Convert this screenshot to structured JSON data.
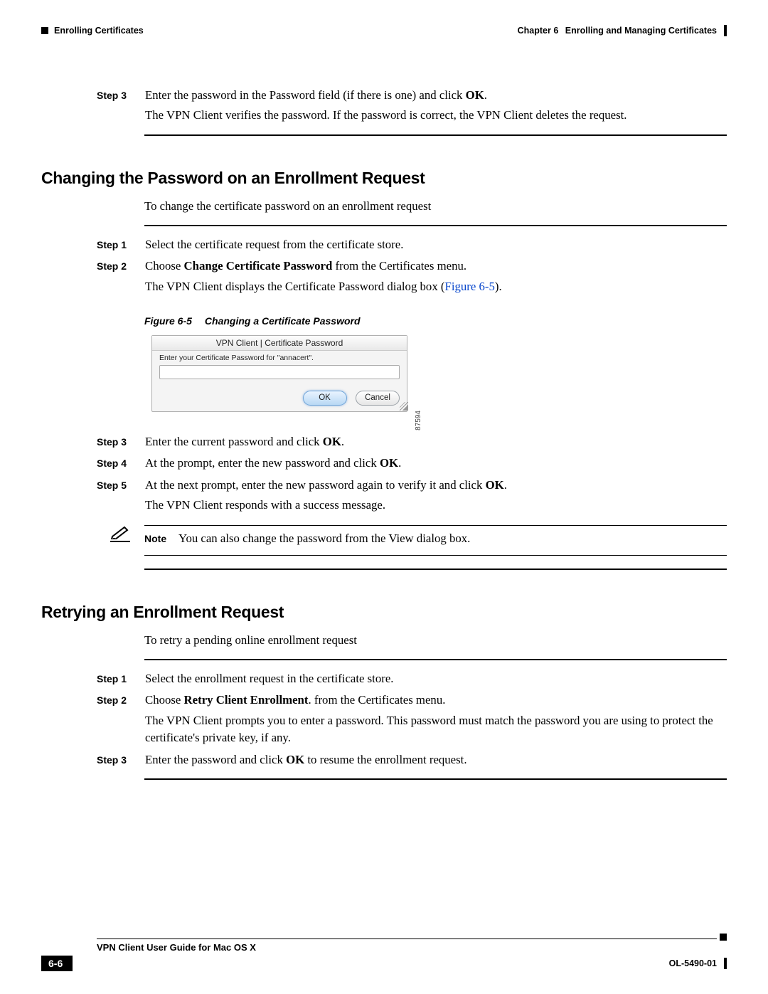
{
  "header": {
    "left_section": "Enrolling Certificates",
    "right_chapter_label": "Chapter 6",
    "right_chapter_title": "Enrolling and Managing Certificates"
  },
  "intro_step": {
    "label": "Step 3",
    "line1a": "Enter the password in the Password field (if there is one) and click ",
    "line1b": "OK",
    "line1c": ".",
    "line2": "The VPN Client verifies the password. If the password is correct, the VPN Client deletes the request."
  },
  "section1": {
    "heading": "Changing the Password on an Enrollment Request",
    "intro": "To change the certificate password on an enrollment request",
    "steps12": [
      {
        "label": "Step 1",
        "text": "Select the certificate request from the certificate store."
      },
      {
        "label": "Step 2",
        "pre": "Choose ",
        "bold": "Change Certificate Password",
        "post": " from the Certificates menu."
      }
    ],
    "step2_extra_a": "The VPN Client displays the Certificate Password dialog box (",
    "step2_extra_link": "Figure 6-5",
    "step2_extra_b": ").",
    "figure": {
      "caption_num": "Figure 6-5",
      "caption_title": "Changing a Certificate Password",
      "dialog_title": "VPN Client  |  Certificate Password",
      "dialog_prompt": "Enter your Certificate Password for \"annacert\".",
      "ok": "OK",
      "cancel": "Cancel",
      "side_num": "87594"
    },
    "steps345": [
      {
        "label": "Step 3",
        "pre": "Enter the current password and click ",
        "bold": "OK",
        "post": "."
      },
      {
        "label": "Step 4",
        "pre": "At the prompt, enter the new password and click ",
        "bold": "OK",
        "post": "."
      },
      {
        "label": "Step 5",
        "pre": "At the next prompt, enter the new password again to verify it and click ",
        "bold": "OK",
        "post": "."
      }
    ],
    "step5_extra": "The VPN Client responds with a success message.",
    "note_label": "Note",
    "note_pre": "You can also change the password from the ",
    "note_bold": "View",
    "note_post": " dialog box."
  },
  "section2": {
    "heading": "Retrying an Enrollment Request",
    "intro": "To retry a pending online enrollment request",
    "steps": [
      {
        "label": "Step 1",
        "text": "Select the enrollment request in the certificate store."
      },
      {
        "label": "Step 2",
        "pre": "Choose ",
        "bold": "Retry Client Enrollment",
        "post": ". from the Certificates menu."
      }
    ],
    "step2_extra": "The VPN Client prompts you to enter a password. This password must match the password you are using to protect the certificate's private key, if any.",
    "step3": {
      "label": "Step 3",
      "pre": "Enter the password and click ",
      "bold": "OK",
      "post": " to resume the enrollment request."
    }
  },
  "footer": {
    "guide_title": "VPN Client User Guide for Mac OS X",
    "page_num": "6-6",
    "doc_id": "OL-5490-01"
  }
}
